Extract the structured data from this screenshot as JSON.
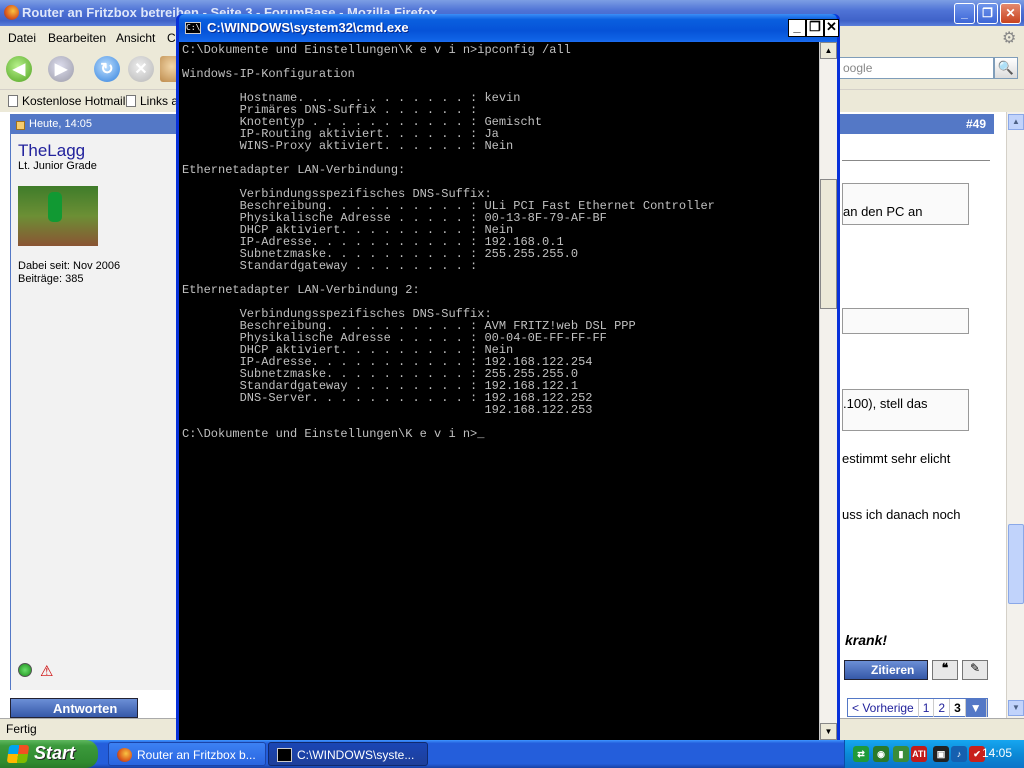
{
  "firefox": {
    "title": "Router an Fritzbox betreiben - Seite 3 - ForumBase - Mozilla Firefox",
    "menu": [
      "Datei",
      "Bearbeiten",
      "Ansicht",
      "C"
    ],
    "search_placeholder": "oogle",
    "bookmarks": [
      "Kostenlose Hotmail",
      "Links a"
    ],
    "status": "Fertig",
    "post": {
      "date": "Heute, 14:05",
      "number": "#49",
      "username": "TheLagg",
      "rank": "Lt. Junior Grade",
      "joined": "Dabei seit: Nov 2006",
      "posts": "Beiträge: 385",
      "quote1": "an den PC an",
      "quote2": "",
      "quote3": ".100), stell das",
      "text1": "estimmt sehr elicht",
      "text2": "uss ich danach noch",
      "signature": "krank!",
      "reply_label": "Antworten",
      "quote_label": "Zitieren"
    },
    "pager": {
      "prev": "< Vorherige",
      "pages": [
        "1",
        "2",
        "3"
      ],
      "current": "3"
    }
  },
  "cmd": {
    "title": "C:\\WINDOWS\\system32\\cmd.exe",
    "icon_text": "C:\\",
    "output": "C:\\Dokumente und Einstellungen\\K e v i n>ipconfig /all\n\nWindows-IP-Konfiguration\n\n        Hostname. . . . . . . . . . . . : kevin\n        Primäres DNS-Suffix . . . . . . :\n        Knotentyp . . . . . . . . . . . : Gemischt\n        IP-Routing aktiviert. . . . . . : Ja\n        WINS-Proxy aktiviert. . . . . . : Nein\n\nEthernetadapter LAN-Verbindung:\n\n        Verbindungsspezifisches DNS-Suffix:\n        Beschreibung. . . . . . . . . . : ULi PCI Fast Ethernet Controller\n        Physikalische Adresse . . . . . : 00-13-8F-79-AF-BF\n        DHCP aktiviert. . . . . . . . . : Nein\n        IP-Adresse. . . . . . . . . . . : 192.168.0.1\n        Subnetzmaske. . . . . . . . . . : 255.255.255.0\n        Standardgateway . . . . . . . . :\n\nEthernetadapter LAN-Verbindung 2:\n\n        Verbindungsspezifisches DNS-Suffix:\n        Beschreibung. . . . . . . . . . : AVM FRITZ!web DSL PPP\n        Physikalische Adresse . . . . . : 00-04-0E-FF-FF-FF\n        DHCP aktiviert. . . . . . . . . : Nein\n        IP-Adresse. . . . . . . . . . . : 192.168.122.254\n        Subnetzmaske. . . . . . . . . . : 255.255.255.0\n        Standardgateway . . . . . . . . : 192.168.122.1\n        DNS-Server. . . . . . . . . . . : 192.168.122.252\n                                          192.168.122.253\n\nC:\\Dokumente und Einstellungen\\K e v i n>_"
  },
  "taskbar": {
    "start_label": "Start",
    "tasks": [
      "Router an Fritzbox b...",
      "C:\\WINDOWS\\syste..."
    ],
    "clock": "14:05",
    "tray_icons": [
      "network-icon",
      "eye-icon",
      "usb-icon",
      "ati-icon",
      "monitor-icon",
      "speaker-icon",
      "security-icon"
    ]
  },
  "colors": {
    "xp_blue": "#245edb",
    "forum_blue": "#5478c6",
    "console_text": "#c0c0c0"
  }
}
